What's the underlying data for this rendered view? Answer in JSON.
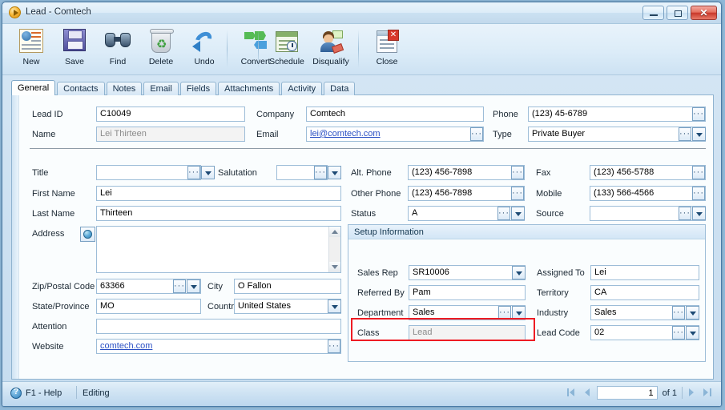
{
  "window": {
    "title": "Lead - Comtech",
    "icon": "lead-orb-icon",
    "controls": {
      "minimize": "minimize",
      "maximize": "maximize",
      "close": "close"
    }
  },
  "toolbar": {
    "buttons": [
      {
        "label": "New",
        "icon": "new-contact-card-icon"
      },
      {
        "label": "Save",
        "icon": "floppy-disk-icon"
      },
      {
        "label": "Find",
        "icon": "binoculars-icon"
      },
      {
        "label": "Delete",
        "icon": "recycle-bin-icon"
      },
      {
        "label": "Undo",
        "icon": "undo-arrow-icon"
      },
      {
        "label": "Convert",
        "icon": "convert-arrows-icon"
      },
      {
        "label": "Schedule",
        "icon": "calendar-clock-icon"
      },
      {
        "label": "Disqualify",
        "icon": "person-tag-icon"
      },
      {
        "label": "Close",
        "icon": "document-close-icon"
      }
    ]
  },
  "tabs": [
    {
      "label": "General",
      "active": true
    },
    {
      "label": "Contacts",
      "active": false
    },
    {
      "label": "Notes",
      "active": false
    },
    {
      "label": "Email",
      "active": false
    },
    {
      "label": "Fields",
      "active": false
    },
    {
      "label": "Attachments",
      "active": false
    },
    {
      "label": "Activity",
      "active": false
    },
    {
      "label": "Data",
      "active": false
    }
  ],
  "header_fields": {
    "lead_id": {
      "label": "Lead ID",
      "value": "C10049"
    },
    "name": {
      "label": "Name",
      "value": "Lei Thirteen",
      "readonly": true
    },
    "company": {
      "label": "Company",
      "value": "Comtech"
    },
    "email": {
      "label": "Email",
      "value": "lei@comtech.com",
      "link": true
    },
    "phone": {
      "label": "Phone",
      "value": "(123) 45-6789"
    },
    "type": {
      "label": "Type",
      "value": "Private Buyer"
    }
  },
  "left_column": {
    "title": {
      "label": "Title",
      "value": ""
    },
    "salutation": {
      "label": "Salutation",
      "value": ""
    },
    "first_name": {
      "label": "First Name",
      "value": "Lei"
    },
    "last_name": {
      "label": "Last Name",
      "value": "Thirteen"
    },
    "address": {
      "label": "Address",
      "value": ""
    },
    "zip": {
      "label": "Zip/Postal Code",
      "value": "63366"
    },
    "city": {
      "label": "City",
      "value": "O Fallon"
    },
    "state": {
      "label": "State/Province",
      "value": "MO"
    },
    "country": {
      "label": "Country",
      "value": "United States"
    },
    "attention": {
      "label": "Attention",
      "value": ""
    },
    "website": {
      "label": "Website",
      "value": "comtech.com",
      "link": true
    }
  },
  "right_column": {
    "alt_phone": {
      "label": "Alt. Phone",
      "value": "(123) 456-7898"
    },
    "fax": {
      "label": "Fax",
      "value": "(123) 456-5788"
    },
    "other_phone": {
      "label": "Other Phone",
      "value": "(123) 456-7898"
    },
    "mobile": {
      "label": "Mobile",
      "value": "(133) 566-4566"
    },
    "status": {
      "label": "Status",
      "value": "A"
    },
    "source": {
      "label": "Source",
      "value": ""
    }
  },
  "setup_information": {
    "title": "Setup Information",
    "sales_rep": {
      "label": "Sales Rep",
      "value": "SR10006"
    },
    "assigned_to": {
      "label": "Assigned To",
      "value": "Lei"
    },
    "referred_by": {
      "label": "Referred By",
      "value": "Pam"
    },
    "territory": {
      "label": "Territory",
      "value": "CA"
    },
    "department": {
      "label": "Department",
      "value": "Sales"
    },
    "industry": {
      "label": "Industry",
      "value": "Sales"
    },
    "class": {
      "label": "Class",
      "value": "Lead",
      "readonly": true,
      "highlighted": true
    },
    "lead_code": {
      "label": "Lead Code",
      "value": "02"
    }
  },
  "status_bar": {
    "help": "F1 - Help",
    "mode": "Editing",
    "page_value": "1",
    "of_label": "of 1",
    "nav": {
      "first": "first-record",
      "previous": "previous-record",
      "next": "next-record",
      "last": "last-record"
    }
  },
  "colors": {
    "highlight_red": "#ee1c24",
    "link_blue": "#2a4fc4",
    "accent_blue": "#9dbdd8"
  }
}
